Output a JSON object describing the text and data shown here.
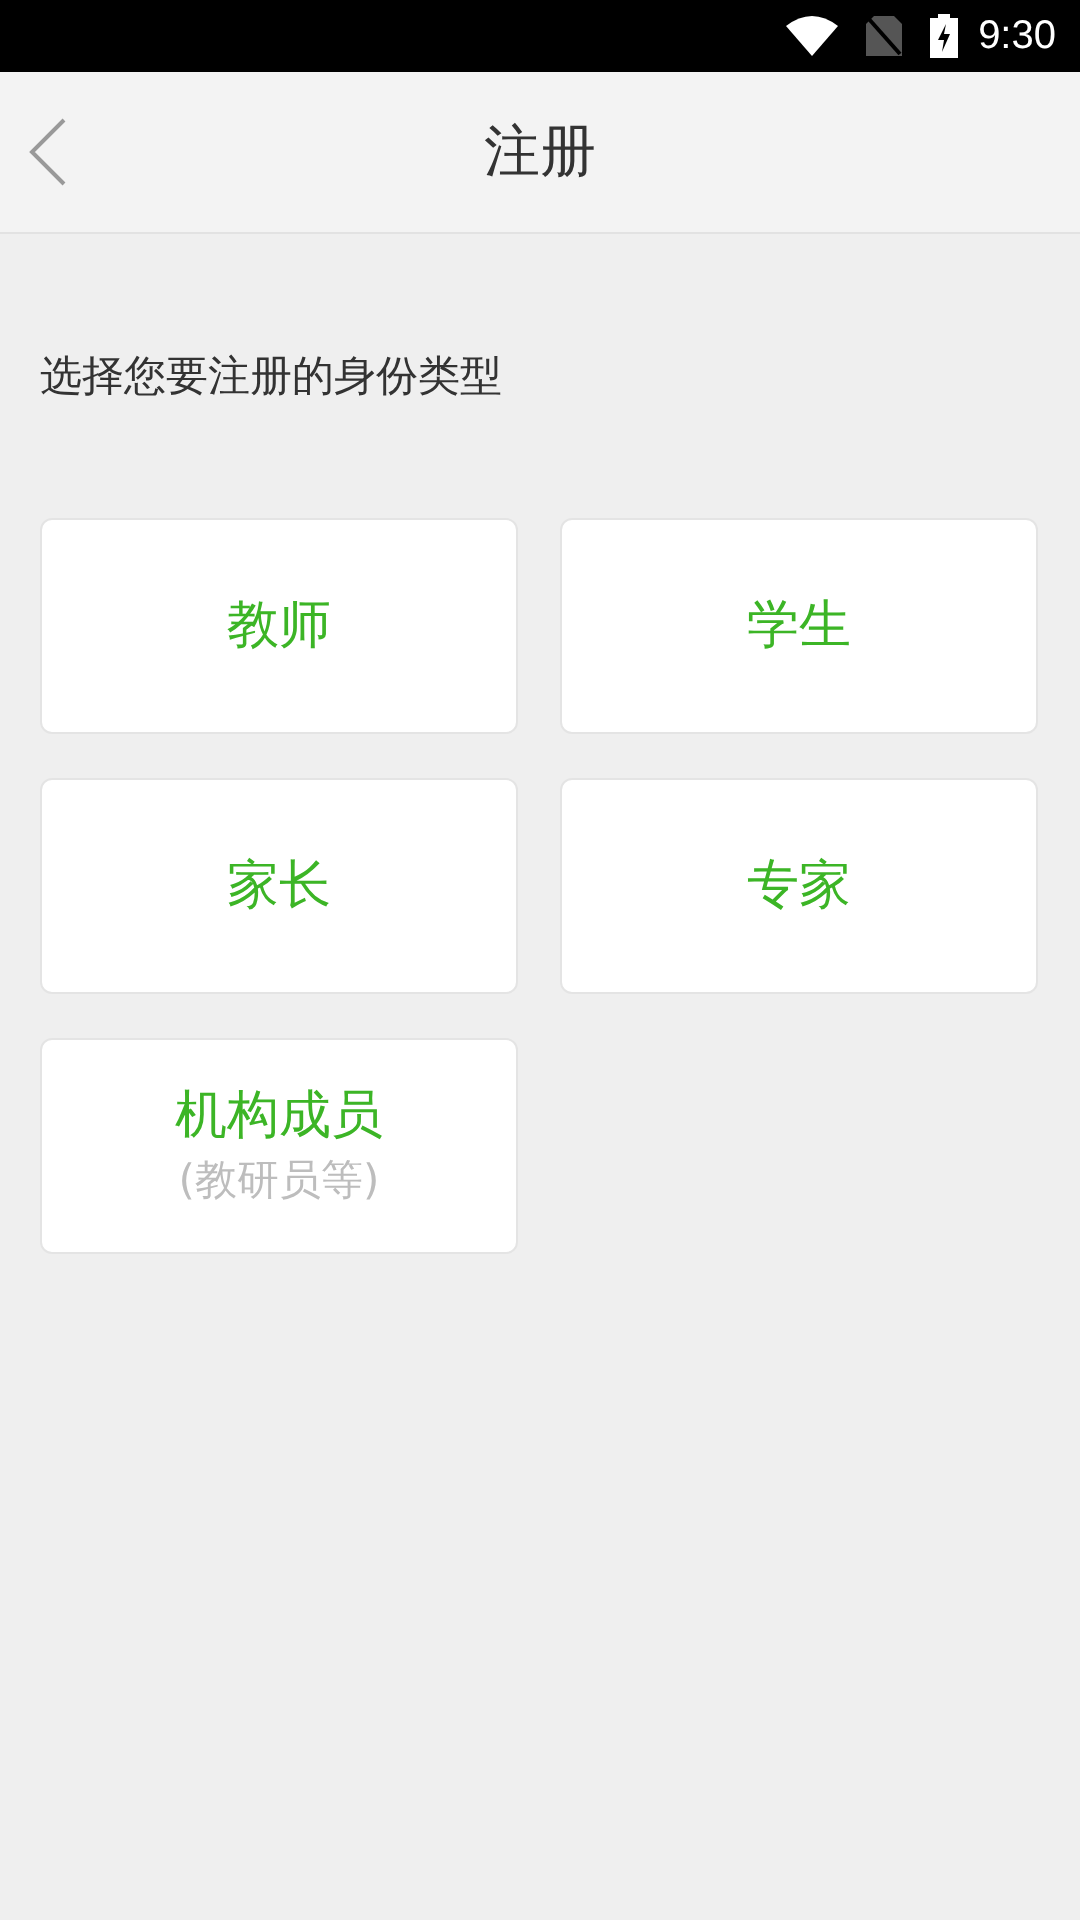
{
  "status_bar": {
    "time": "9:30"
  },
  "header": {
    "title": "注册"
  },
  "prompt": "选择您要注册的身份类型",
  "options": [
    {
      "label": "教师"
    },
    {
      "label": "学生"
    },
    {
      "label": "家长"
    },
    {
      "label": "专家"
    },
    {
      "label": "机构成员",
      "note": "(教研员等)"
    }
  ]
}
